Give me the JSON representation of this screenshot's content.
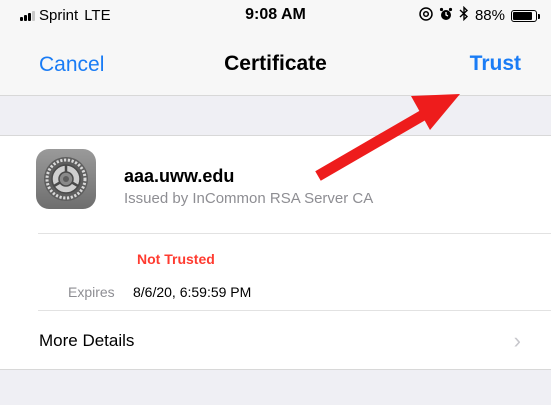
{
  "status_bar": {
    "carrier": "Sprint",
    "network": "LTE",
    "time": "9:08 AM",
    "battery_percent": "88%",
    "battery_level": 0.88,
    "icons": [
      "signal-icon",
      "at-symbol-icon",
      "alarm-icon",
      "bluetooth-icon",
      "battery-icon"
    ]
  },
  "nav": {
    "cancel_label": "Cancel",
    "title": "Certificate",
    "trust_label": "Trust"
  },
  "certificate": {
    "icon": "gear-icon",
    "name": "aaa.uww.edu",
    "issuer": "Issued by InCommon RSA Server CA",
    "status": "Not Trusted",
    "expires_label": "Expires",
    "expires_value": "8/6/20, 6:59:59 PM"
  },
  "details": {
    "more_label": "More Details",
    "chevron": "›"
  },
  "annotation": {
    "icon": "red-arrow-icon",
    "color": "#ee1c1c"
  },
  "colors": {
    "accent": "#1a7cf5",
    "warning": "#ff3b30",
    "secondary_text": "#8e8e93"
  }
}
